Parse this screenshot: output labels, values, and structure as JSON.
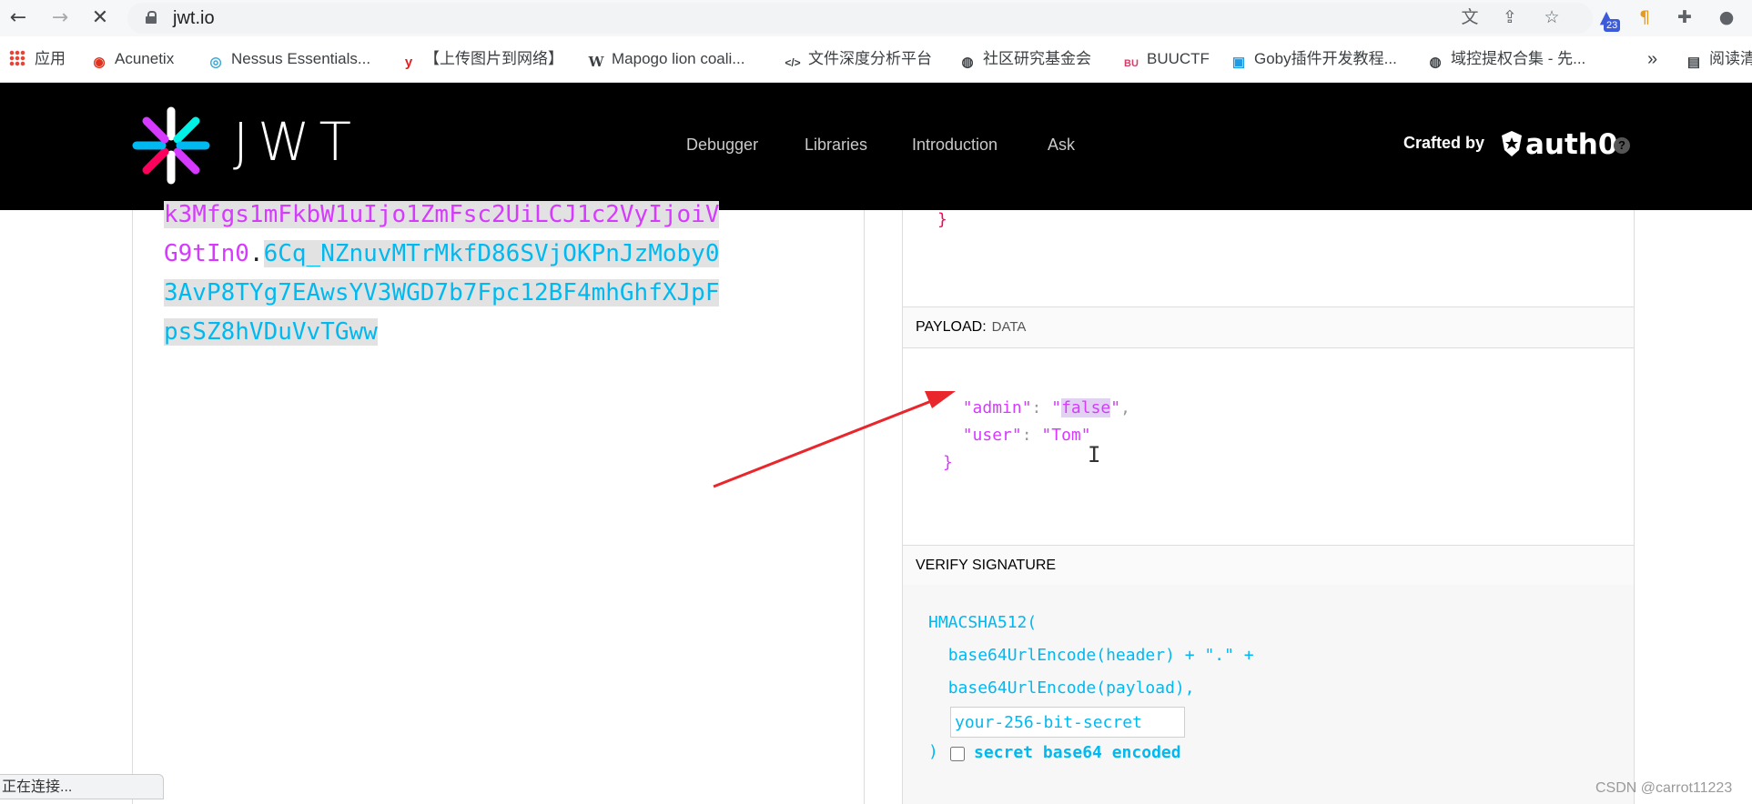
{
  "browser": {
    "url": "jwt.io",
    "extension_badge": "23",
    "status_text": "正在连接..."
  },
  "bookmarks": [
    {
      "label": "应用",
      "icon": "apps-grid-icon"
    },
    {
      "label": "Acunetix",
      "icon": "acunetix-icon"
    },
    {
      "label": "Nessus Essentials...",
      "icon": "nessus-icon"
    },
    {
      "label": "【上传图片到网络】",
      "icon": "y-icon"
    },
    {
      "label": "Mapogo lion coali...",
      "icon": "wikipedia-icon"
    },
    {
      "label": "文件深度分析平台",
      "icon": "code-icon"
    },
    {
      "label": "社区研究基金会",
      "icon": "globe-icon"
    },
    {
      "label": "BUUCTF",
      "icon": "buuctf-icon"
    },
    {
      "label": "Goby插件开发教程...",
      "icon": "bilibili-icon"
    },
    {
      "label": "域控提权合集 - 先...",
      "icon": "globe-icon"
    }
  ],
  "bookmarks_more": "»",
  "reading_list": "阅读清单",
  "site": {
    "logo_text": "JWT",
    "nav": [
      "Debugger",
      "Libraries",
      "Introduction",
      "Ask"
    ],
    "crafted_by": "Crafted by",
    "auth0": "auth0"
  },
  "encoded": {
    "line1": "k3Mfgs1mFkbW1uIjo1ZmFsc2UiLCJ1c2VyIjoiV",
    "line2_payload": "G9tIn0",
    "line2_dot": ".",
    "line2_sig": "6Cq_NZnuvMTrMkfD86SVjOKPnJzMoby0",
    "line3": "3AvP8TYg7EAwsYV3WGD7b7Fpc12BF4mhGhfXJpF",
    "line4": "psSZ8hVDuVvTGww"
  },
  "decoded": {
    "header_tail": "}",
    "payload_title": "PAYLOAD:",
    "payload_sub": "DATA",
    "payload_admin_key": "\"admin\"",
    "payload_admin_value": "false",
    "payload_user_key": "\"user\"",
    "payload_user_value": "\"Tom\"",
    "payload_close": "}",
    "verify_title": "VERIFY SIGNATURE",
    "sig_line1": "HMACSHA512(",
    "sig_line2": "base64UrlEncode(header) + \".\" +",
    "sig_line3": "base64UrlEncode(payload),",
    "secret_placeholder": "your-256-bit-secret",
    "paren_close": ")",
    "b64_label": "secret base64 encoded"
  },
  "watermark": "CSDN @carrot11223",
  "colors": {
    "payload": "#d63aff",
    "signature": "#00b9f1",
    "header": "#fb015b",
    "annotation_arrow": "#e8262b"
  }
}
